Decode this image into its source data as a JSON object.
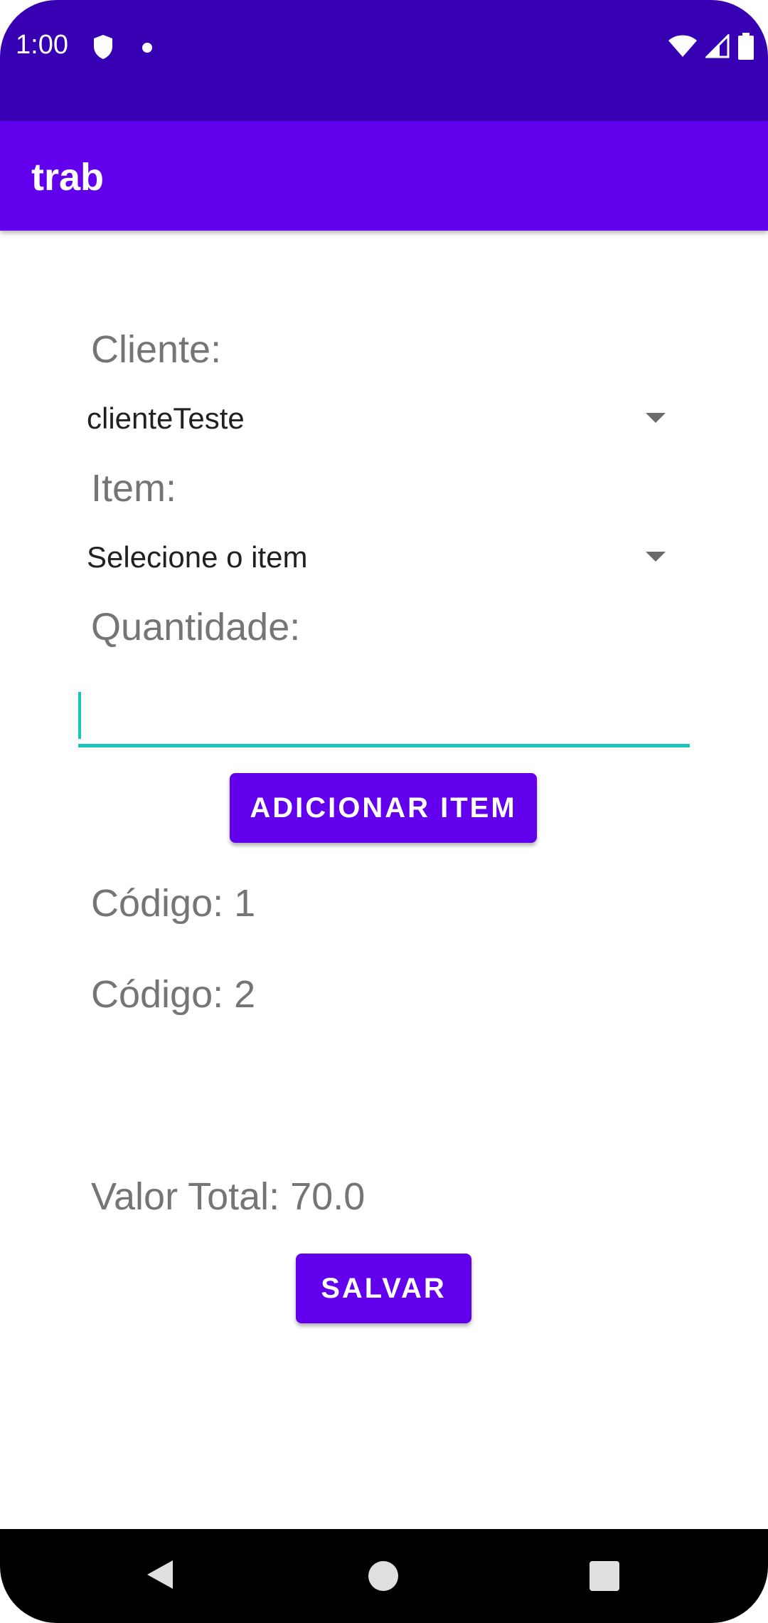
{
  "status_bar": {
    "time": "1:00",
    "icons": [
      "shield-icon",
      "notification-dot-icon",
      "wifi-icon",
      "cell-signal-icon",
      "battery-icon"
    ]
  },
  "app_bar": {
    "title": "trab"
  },
  "form": {
    "cliente_label": "Cliente:",
    "cliente_selected": "clienteTeste",
    "item_label": "Item:",
    "item_selected": "Selecione o item",
    "quantidade_label": "Quantidade:",
    "quantidade_value": "",
    "add_button_label": "ADICIONAR ITEM"
  },
  "items": [
    {
      "text": "Código: 1"
    },
    {
      "text": "Código: 2"
    }
  ],
  "total": {
    "text": "Valor Total: 70.0"
  },
  "save_button_label": "SALVAR",
  "nav_bar": {
    "icons": [
      "back-icon",
      "home-icon",
      "recents-icon"
    ]
  },
  "colors": {
    "status_bar": "#3700b3",
    "primary": "#6200ee",
    "accent": "#1ac6bc"
  }
}
